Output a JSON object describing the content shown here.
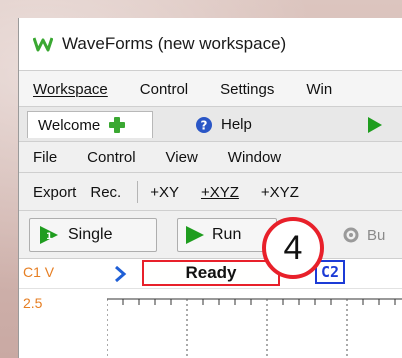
{
  "window": {
    "title": "WaveForms (new workspace)"
  },
  "menubar": {
    "items": [
      "Workspace",
      "Control",
      "Settings",
      "Win"
    ]
  },
  "tabs": {
    "welcome": "Welcome",
    "help": "Help"
  },
  "file_menu": {
    "items": [
      "File",
      "Control",
      "View",
      "Window"
    ]
  },
  "toolbar": {
    "export": "Export",
    "rec": "Rec.",
    "xy": "+XY",
    "xyz": "+XYZ",
    "xyz2": "+XYZ"
  },
  "actions": {
    "single": "Single",
    "run": "Run",
    "bu": "Bu"
  },
  "status": {
    "channel": "C1 V",
    "state": "Ready",
    "c1": "C1",
    "c2": "C2"
  },
  "plot": {
    "y_top": "2.5"
  },
  "callout": {
    "number": "4"
  },
  "colors": {
    "ready_border": "#e8202a",
    "c1": "#f28c00",
    "c2": "#1c3bd6",
    "callout": "#e8202a",
    "play_green": "#1f9d1f"
  }
}
